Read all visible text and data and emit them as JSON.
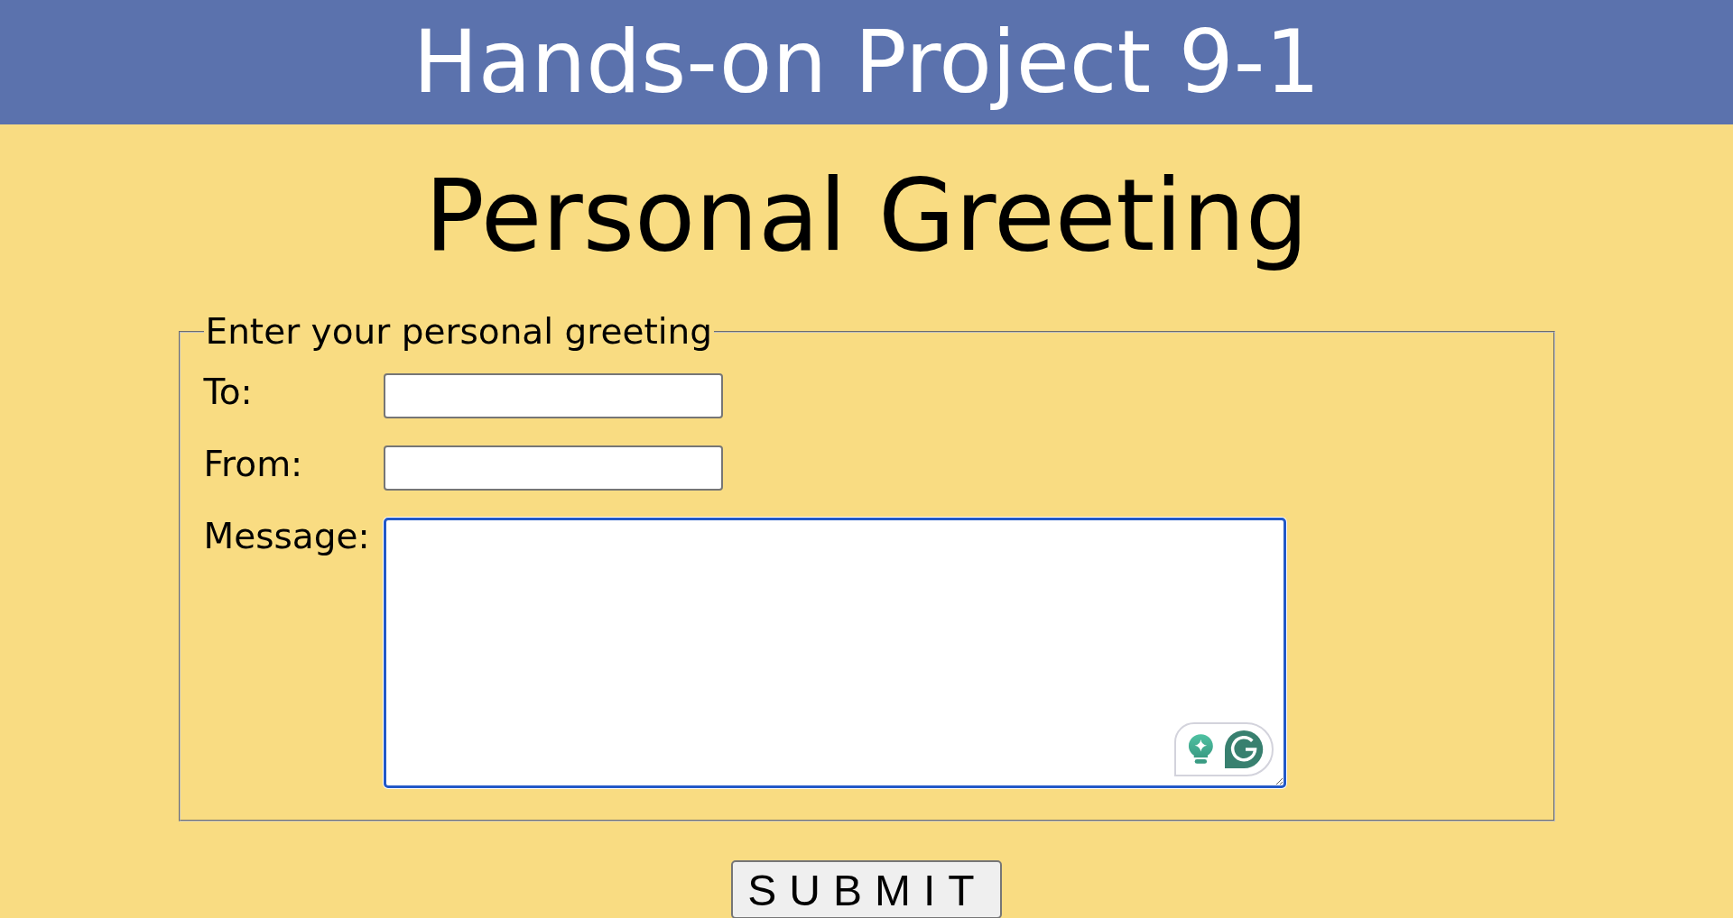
{
  "header": {
    "title": "Hands-on Project 9-1"
  },
  "heading": "Personal Greeting",
  "form": {
    "legend": "Enter your personal greeting",
    "fields": [
      {
        "kind": "text",
        "label": "To:",
        "focused": false
      },
      {
        "kind": "text",
        "label": "From:",
        "focused": false
      },
      {
        "kind": "textarea",
        "label": "Message:",
        "focused": true
      }
    ],
    "submit": {
      "label": "SUBMIT"
    }
  }
}
